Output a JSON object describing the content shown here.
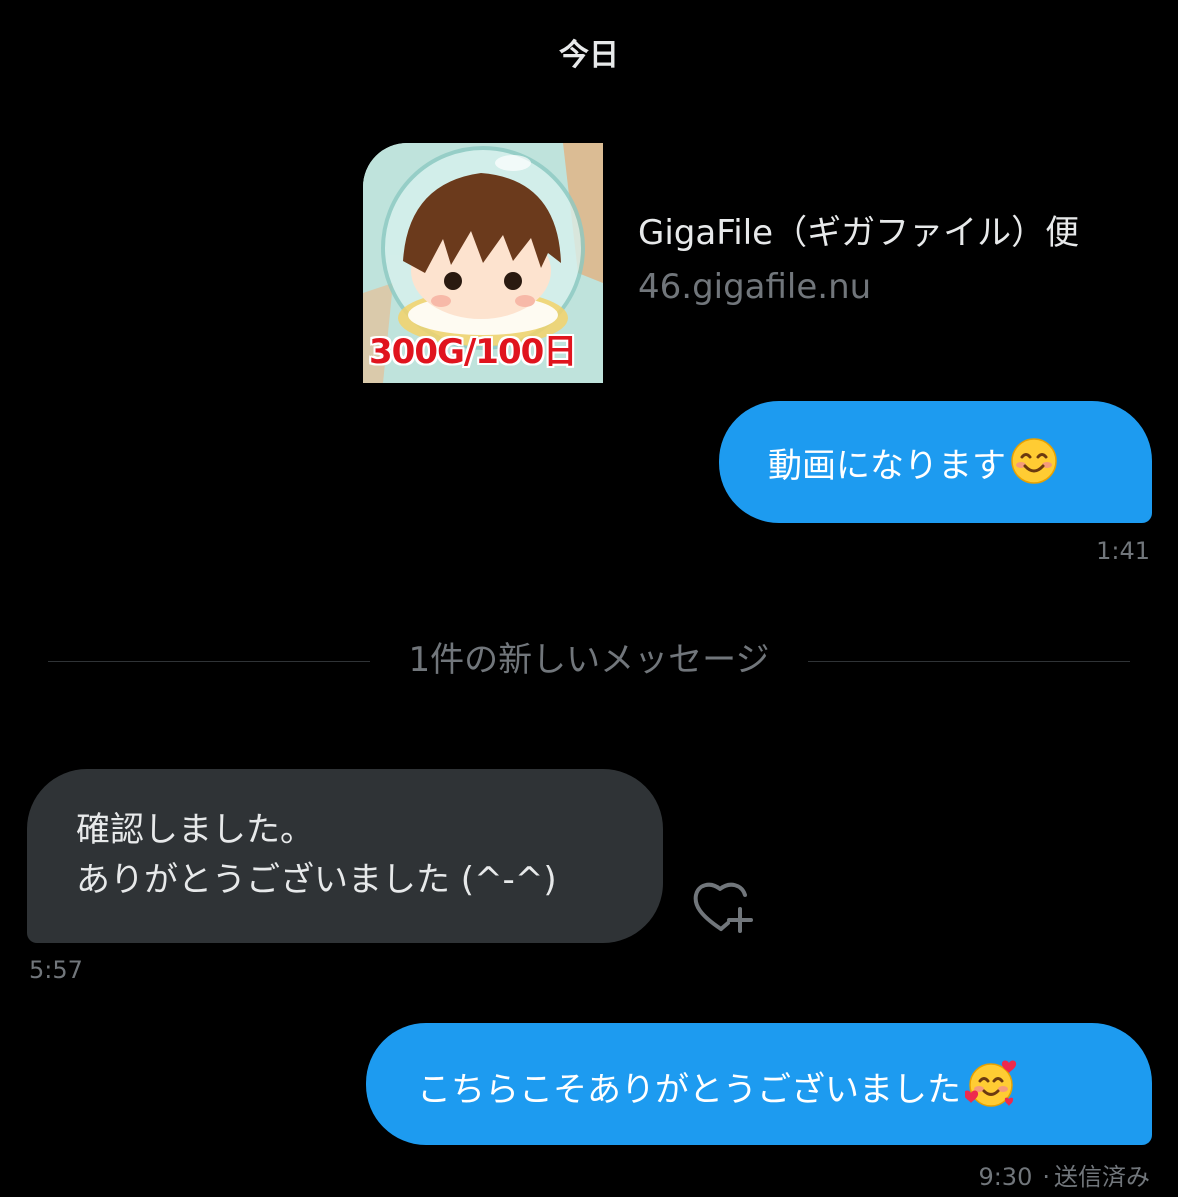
{
  "date_header": "今日",
  "link_card": {
    "thumbnail_caption": "300G/100日",
    "title": "GigaFile（ギガファイル）便",
    "domain": "46.gigafile.nu"
  },
  "messages": [
    {
      "direction": "outgoing",
      "text": "動画になります",
      "emoji": "smiling-face-icon",
      "time": "1:41"
    },
    {
      "direction": "incoming",
      "lines": [
        "確認しました。",
        "ありがとうございました (^-^)"
      ],
      "time": "5:57"
    },
    {
      "direction": "outgoing",
      "text": "こちらこそありがとうございました",
      "emoji": "smiling-face-with-hearts-icon",
      "time": "9:30",
      "status": "送信済み"
    }
  ],
  "divider_label": "1件の新しいメッセージ",
  "colors": {
    "background": "#000000",
    "outgoing_bubble": "#1d9bf0",
    "incoming_bubble": "#2f3336",
    "secondary_text": "#71767b"
  }
}
